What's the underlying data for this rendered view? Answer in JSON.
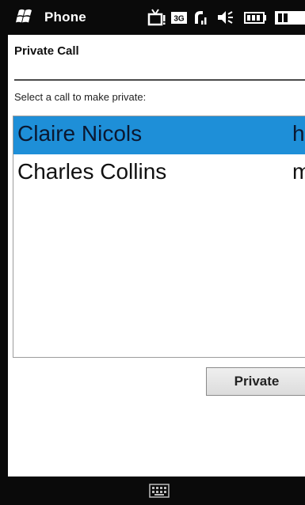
{
  "statusbar": {
    "app_title": "Phone",
    "icons": [
      "windows-start-icon",
      "tv-notification-icon",
      "3g-icon",
      "signal-icon",
      "volume-icon",
      "battery-icon"
    ],
    "accent_color": "#0a0a0a"
  },
  "page": {
    "title": "Private Call",
    "instruction": "Select a call to make private:"
  },
  "calls": [
    {
      "name": "Claire Nicols",
      "type": "h",
      "selected": true
    },
    {
      "name": "Charles Collins",
      "type": "m",
      "selected": false
    }
  ],
  "selection_color": "#1e8fd8",
  "actions": {
    "private_label": "Private"
  },
  "softkeys": {
    "center_icon": "keyboard-icon"
  }
}
